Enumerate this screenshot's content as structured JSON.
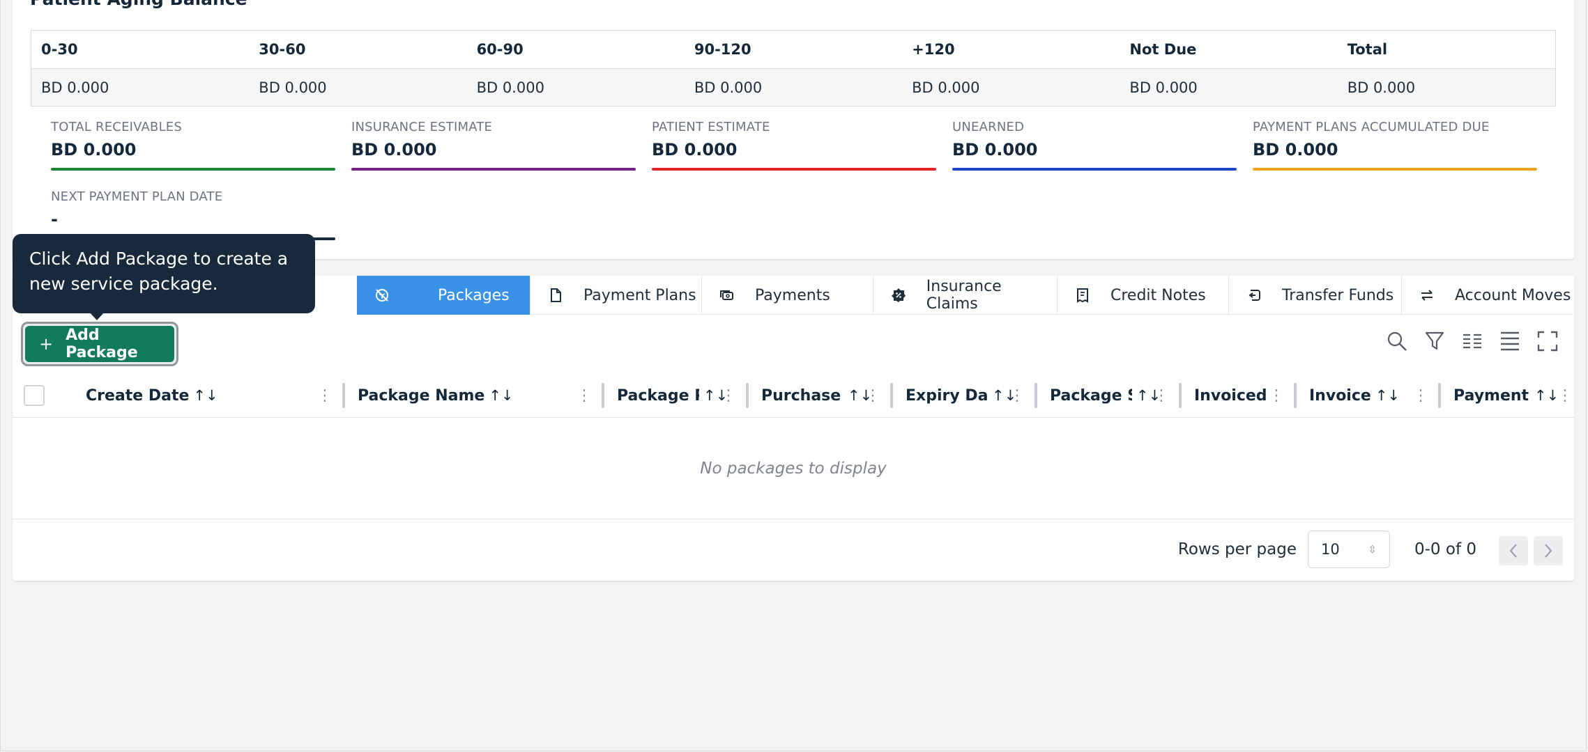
{
  "aging": {
    "title": "Patient Aging Balance",
    "headers": [
      "0-30",
      "30-60",
      "60-90",
      "90-120",
      "+120",
      "Not Due",
      "Total"
    ],
    "values": [
      "BD 0.000",
      "BD 0.000",
      "BD 0.000",
      "BD 0.000",
      "BD 0.000",
      "BD 0.000",
      "BD 0.000"
    ]
  },
  "kpis": [
    {
      "label": "TOTAL RECEIVABLES",
      "value": "BD 0.000",
      "color": "#1a8a2e"
    },
    {
      "label": "INSURANCE ESTIMATE",
      "value": "BD 0.000",
      "color": "#7a1f8a"
    },
    {
      "label": "PATIENT ESTIMATE",
      "value": "BD 0.000",
      "color": "#e0242a"
    },
    {
      "label": "UNEARNED",
      "value": "BD 0.000",
      "color": "#1f45c8"
    },
    {
      "label": "PAYMENT PLANS ACCUMULATED DUE",
      "value": "BD 0.000",
      "color": "#f2a51c"
    },
    {
      "label": "NEXT PAYMENT PLAN DATE",
      "value": "-",
      "color": "#14283a"
    }
  ],
  "tabs": [
    {
      "label": "Packages",
      "icon": "package-off-icon"
    },
    {
      "label": "Payment Plans",
      "icon": "document-icon"
    },
    {
      "label": "Payments",
      "icon": "cash-icon"
    },
    {
      "label": "Insurance Claims",
      "icon": "shield-badge-icon"
    },
    {
      "label": "Credit Notes",
      "icon": "receipt-icon"
    },
    {
      "label": "Transfer Funds",
      "icon": "transfer-icon"
    },
    {
      "label": "Account Moves",
      "icon": "swap-arrows-icon"
    }
  ],
  "toolbar": {
    "add_label": "Add Package",
    "add_icon": "+"
  },
  "table": {
    "columns": [
      {
        "label": "Create Date",
        "sort": "↑↓"
      },
      {
        "label": "Package Name",
        "sort": "↑↓"
      },
      {
        "label": "Package Pr",
        "sort": "↑↓"
      },
      {
        "label": "Purchase D",
        "sort": "↑↓"
      },
      {
        "label": "Expiry Date",
        "sort": "↑↓"
      },
      {
        "label": "Package St",
        "sort": "↑↓"
      },
      {
        "label": "Invoiced",
        "sort": ""
      },
      {
        "label": "Invoice",
        "sort": "↑↓"
      },
      {
        "label": "Payment S",
        "sort": "↑↓"
      }
    ],
    "empty_text": "No packages to display"
  },
  "pagination": {
    "rows_per_page_label": "Rows per page",
    "rows_per_page_value": "10",
    "range": "0-0 of 0"
  },
  "tooltip": {
    "text_line1": "Click Add Package to create a",
    "text_line2": "new service package."
  },
  "colors": {
    "accent": "#3a92e8",
    "primary_button": "#147a5d",
    "tooltip_bg": "#17293a"
  }
}
